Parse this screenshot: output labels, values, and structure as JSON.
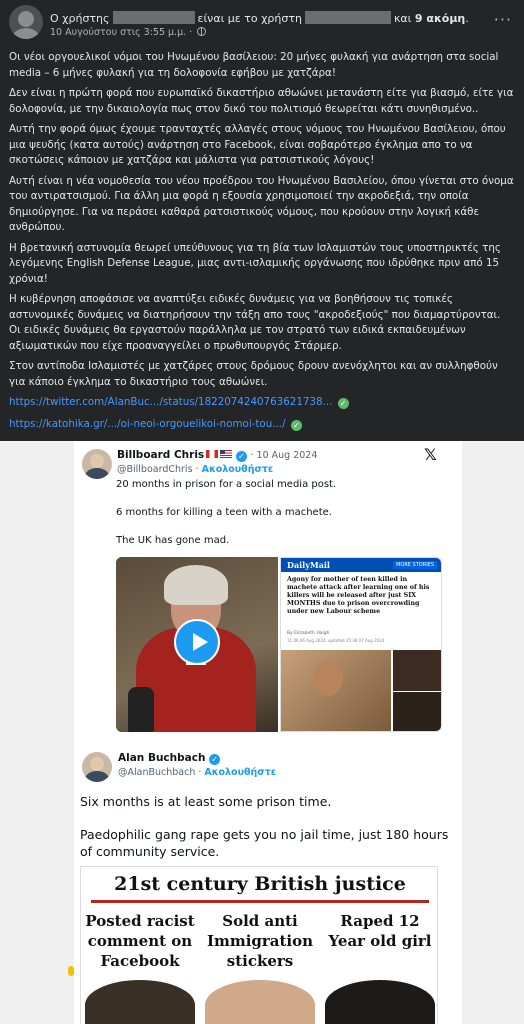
{
  "header": {
    "prefix": "Ο χρήστης",
    "middle": "είναι με το χρήστη",
    "suffix_and": "και",
    "suffix_more": "9 ακόμη",
    "suffix_dot": ".",
    "date": "10 Αυγούστου στις 3:55 μ.μ.",
    "date_sep": "·",
    "privacy_icon": "globe-icon",
    "more_icon": "more-icon"
  },
  "post": {
    "paragraphs": [
      "Οι νέοι οργουελικοί νόμοι του Ηνωμένου βασίλειου: 20 μήνες φυλακή για ανάρτηση στα social media – 6 μήνες φυλακή για τη δολοφονία εφήβου με χατζάρα!",
      "Δεν είναι η πρώτη φορά που ευρωπαϊκό δικαστήριο αθωώνει μετανάστη είτε για βιασμό, είτε για δολοφονία, με την δικαιολογία πως στον δικό του πολιτισμό θεωρείται κάτι συνηθισμένο..",
      "Αυτή την φορά όμως έχουμε τρανταχτές αλλαγές στους νόμους του Ηνωμένου Βασίλειου, όπου μια ψευδής (κατα αυτούς) ανάρτηση στο Facebook, είναι σοβαρότερο έγκλημα απο το να σκοτώσεις κάποιον με χατζάρα και μάλιστα για ρατσιστικούς λόγους!",
      "Αυτή είναι η νέα νομοθεσία του νέου προέδρου του Ηνωμένου Βασιλείου, όπου γίνεται στο όνομα του αντιρατσισμού. Για άλλη μια φορά η εξουσία χρησιμοποιεί την ακροδεξιά, την οποία δημιούργησε. Για να περάσει καθαρά ρατσιστικούς νόμους, που κρούουν στην λογική κάθε ανθρώπου.",
      "Η βρετανική αστυνομία θεωρεί υπεύθυνους για τη βία των Ισλαμιστών τους υποστηρικτές της λεγόμενης English Defense League, μιας αντι-ισλαμικής οργάνωσης που ιδρύθηκε πριν από 15 χρόνια!",
      "Η κυβέρνηση αποφάσισε να αναπτύξει ειδικές δυνάμεις για να βοηθήσουν τις τοπικές αστυνομικές δυνάμεις να διατηρήσουν την τάξη απο τους \"ακροδεξιούς\" που διαμαρτύρονται. Οι ειδικές δυνάμεις θα εργαστούν παράλληλα με τον στρατό των ειδικά εκπαιδευμένων αξιωματικών που είχε προαναγγείλει ο πρωθυπουργός Στάρμερ.",
      "Στον αντίποδα Ισλαμιστές με χατζάρες στους δρόμους δρουν ανενόχλητοι και αν συλληφθούν για κάποιο έγκλημα το δικαστήριο τους αθωώνει."
    ],
    "links": [
      "https://twitter.com/AlanBuc.../status/1822074240763621738...",
      "https://katohika.gr/.../oi-neoi-orgouelikoi-nomoi-tou.../"
    ]
  },
  "tweet1": {
    "name": "Billboard Chris",
    "date": "· 10 Aug 2024",
    "handle": "@BillboardChris",
    "follow": "Ακολουθήστε",
    "lines": [
      "20 months in prison for a social media post.",
      "6 months for killing a teen with a machete.",
      "The UK has gone mad."
    ],
    "dm_logo": "DailyMail",
    "dm_more": "MORE STORIES",
    "dm_headline": "Agony for mother of teen killed in machete attack after learning one of his killers will be released after just SIX MONTHS due to prison overcrowding under new Labour scheme",
    "dm_byline": "By Elizabeth Haigh",
    "dm_date": "11:46 06 Aug 2024, updated 15:38 07 Aug 2024"
  },
  "tweet2": {
    "name": "Alan Buchbach",
    "handle": "@AlanBuchbach",
    "follow": "Ακολουθήστε",
    "line1": "Six months is at least some prison time.",
    "line2": "Paedophilic gang rape gets you no jail time, just 180 hours of community service.",
    "image_title": "21st century British justice",
    "columns": [
      "Posted racist comment on Facebook",
      "Sold anti Immigration stickers",
      "Raped 12 Year old girl"
    ]
  },
  "colors": {
    "background": "#242526",
    "link": "#4599ff",
    "twitter_blue": "#1d9bf0",
    "title_rule": "#b3261e"
  }
}
